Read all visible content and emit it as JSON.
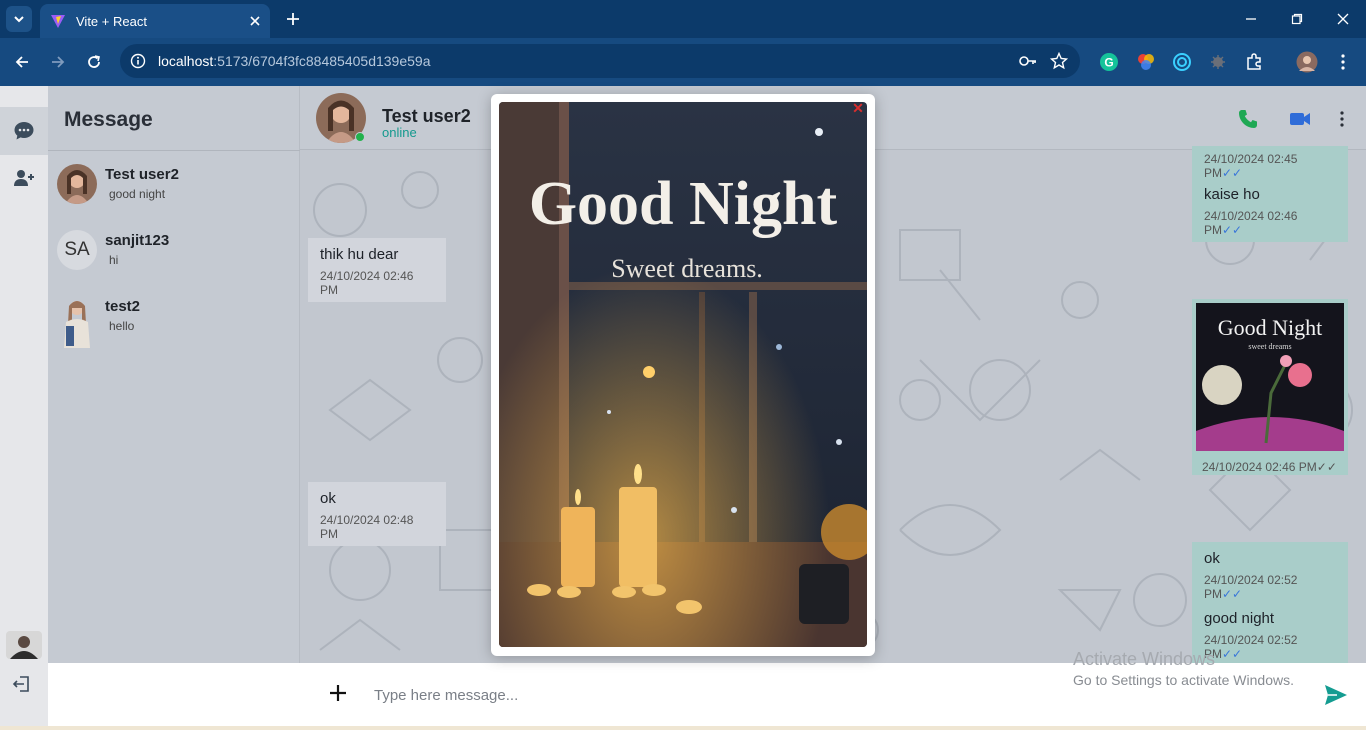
{
  "browser": {
    "tab_title": "Vite + React",
    "url_host": "localhost",
    "url_path": ":5173/6704f3fc88485405d139e59a"
  },
  "sidebar": {
    "title": "Message",
    "contacts": [
      {
        "name": "Test user2",
        "last": "good night",
        "avatar_initials": ""
      },
      {
        "name": "sanjit123",
        "last": "hi",
        "avatar_initials": "SA"
      },
      {
        "name": "test2",
        "last": "hello",
        "avatar_initials": ""
      }
    ]
  },
  "chat": {
    "name": "Test user2",
    "status": "online",
    "messages": [
      {
        "dir": "out",
        "text": "",
        "time": "24/10/2024 02:45 PM"
      },
      {
        "dir": "out",
        "text": "kaise ho",
        "time": "24/10/2024 02:46 PM"
      },
      {
        "dir": "in",
        "text": "thik hu dear",
        "time": "24/10/2024 02:46 PM"
      },
      {
        "dir": "out",
        "image_caption": "Good Night",
        "image_sub": "sweet dreams",
        "time": "24/10/2024 02:46 PM"
      },
      {
        "dir": "in",
        "text": "ok",
        "time": "24/10/2024 02:48 PM"
      },
      {
        "dir": "out",
        "text": "ok",
        "time": "24/10/2024 02:52 PM"
      },
      {
        "dir": "out",
        "text": "good night",
        "time": "24/10/2024 02:52 PM"
      }
    ],
    "tick": "✓✓"
  },
  "modal": {
    "image_title": "Good Night",
    "image_subtitle": "Sweet dreams.",
    "close": "✕"
  },
  "compose": {
    "placeholder": "Type here message..."
  },
  "watermark": {
    "line1": "Activate Windows",
    "line2": "Go to Settings to activate Windows."
  },
  "colors": {
    "chrome_dark": "#0c3a6a",
    "chrome_tab": "#1a4f87",
    "accent": "#14998e",
    "out_bubble": "#a9cdc9",
    "in_bubble": "#d2d5dc"
  }
}
